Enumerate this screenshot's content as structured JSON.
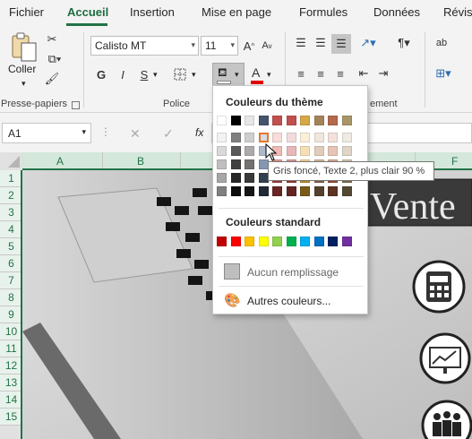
{
  "tabs": [
    "Fichier",
    "Accueil",
    "Insertion",
    "Mise en page",
    "Formules",
    "Données",
    "Révis"
  ],
  "ribbon": {
    "clipboard": {
      "paste_label": "Coller",
      "group_label": "Presse-papiers"
    },
    "font": {
      "name": "Calisto MT",
      "size": "11",
      "bold": "G",
      "italic": "I",
      "underline": "S",
      "group_label": "Police"
    },
    "alignment": {
      "group_label": "ement"
    },
    "number": {
      "abc": "ab"
    }
  },
  "formula_bar": {
    "cell_ref": "A1",
    "fx": "fx"
  },
  "columns": [
    "A",
    "B",
    "F"
  ],
  "rows": [
    "1",
    "2",
    "3",
    "4",
    "5",
    "6",
    "7",
    "8",
    "9",
    "10",
    "11",
    "12",
    "13",
    "14",
    "15"
  ],
  "sheet": {
    "banner_text": "Vente"
  },
  "color_menu": {
    "theme_title": "Couleurs du thème",
    "standard_title": "Couleurs standard",
    "no_fill": "Aucun remplissage",
    "more_colors": "Autres couleurs...",
    "theme_colors": [
      [
        "#ffffff",
        "#000000",
        "#e7e6e6",
        "#44546a",
        "#c0504d",
        "#c0504d",
        "#d6a847",
        "#a5835a",
        "#b4694a",
        "#a89668"
      ],
      [
        "#f2f2f2",
        "#808080",
        "#d0cece",
        "#d6dce4",
        "#f7dcd9",
        "#f2dcdb",
        "#fbefda",
        "#efe6dc",
        "#f3e1da",
        "#efebe3"
      ],
      [
        "#d9d9d9",
        "#595959",
        "#aeaaaa",
        "#adb9ca",
        "#eebab5",
        "#e6b8b7",
        "#f6dfb5",
        "#dfcdb9",
        "#e7c4b5",
        "#dfd6c7"
      ],
      [
        "#bfbfbf",
        "#404040",
        "#757171",
        "#8496b0",
        "#e69891",
        "#d99694",
        "#f1cf90",
        "#cfb497",
        "#dba690",
        "#cfc2ab"
      ],
      [
        "#a6a6a6",
        "#262626",
        "#3a3838",
        "#323f4f",
        "#9c3b36",
        "#953735",
        "#b48726",
        "#7d6142",
        "#8f4c31",
        "#7c6c4c"
      ],
      [
        "#7f7f7f",
        "#0d0d0d",
        "#171616",
        "#222a35",
        "#682724",
        "#632523",
        "#785a19",
        "#53412c",
        "#5f3321",
        "#534833"
      ]
    ],
    "standard_colors": [
      "#c00000",
      "#ff0000",
      "#ffc000",
      "#ffff00",
      "#92d050",
      "#00b050",
      "#00b0f0",
      "#0070c0",
      "#002060",
      "#7030a0"
    ],
    "tooltip": "Gris foncé, Texte 2, plus clair 90 %"
  }
}
